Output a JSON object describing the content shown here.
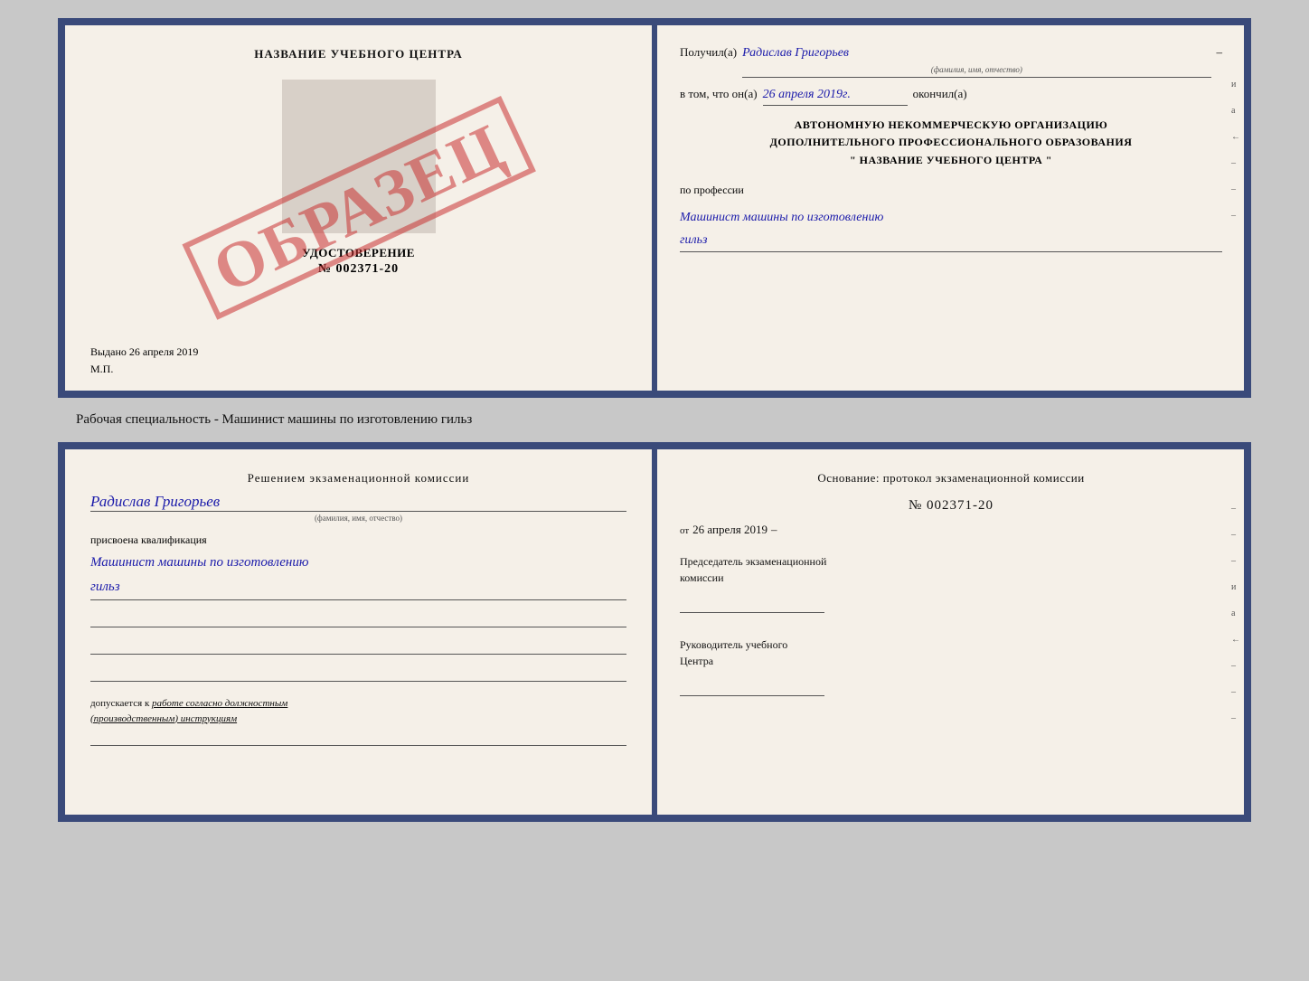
{
  "top_left": {
    "center_title": "НАЗВАНИЕ УЧЕБНОГО ЦЕНТРА",
    "cert_label": "УДОСТОВЕРЕНИЕ",
    "cert_number": "№ 002371-20",
    "issued_line": "Выдано 26 апреля 2019",
    "mp_label": "М.П.",
    "obrazec": "ОБРАЗЕЦ"
  },
  "top_right": {
    "received_label": "Получил(а)",
    "person_name": "Радислав Григорьев",
    "person_sublabel": "(фамилия, имя, отчество)",
    "in_that_label": "в том, что он(а)",
    "date_value": "26 апреля 2019г.",
    "finished_label": "окончил(а)",
    "org_line1": "АВТОНОМНУЮ НЕКОММЕРЧЕСКУЮ ОРГАНИЗАЦИЮ",
    "org_line2": "ДОПОЛНИТЕЛЬНОГО ПРОФЕССИОНАЛЬНОГО ОБРАЗОВАНИЯ",
    "org_line3": "\"   НАЗВАНИЕ УЧЕБНОГО ЦЕНТРА   \"",
    "profession_label": "по профессии",
    "profession_value1": "Машинист машины по изготовлению",
    "profession_value2": "гильз",
    "side_marks": [
      "и",
      "а",
      "←",
      "–",
      "–",
      "–"
    ]
  },
  "between": {
    "label": "Рабочая специальность - Машинист машины по изготовлению гильз"
  },
  "bottom_left": {
    "decision_title": "Решением  экзаменационной  комиссии",
    "person_name": "Радислав Григорьев",
    "person_sublabel": "(фамилия, имя, отчество)",
    "qualification_label": "присвоена квалификация",
    "qualification_value1": "Машинист  машины  по  изготовлению",
    "qualification_value2": "гильз",
    "admission_text": "допускается к",
    "admission_italic": "работе согласно должностным",
    "admission_italic2": "(производственным) инструкциям"
  },
  "bottom_right": {
    "basis_title": "Основание:  протокол  экзаменационной  комиссии",
    "protocol_number": "№  002371-20",
    "date_of_label": "от",
    "date_value": "26 апреля 2019",
    "chairman_label1": "Председатель экзаменационной",
    "chairman_label2": "комиссии",
    "director_label1": "Руководитель учебного",
    "director_label2": "Центра",
    "side_marks": [
      "–",
      "–",
      "–",
      "и",
      "а",
      "←",
      "–",
      "–",
      "–"
    ]
  }
}
